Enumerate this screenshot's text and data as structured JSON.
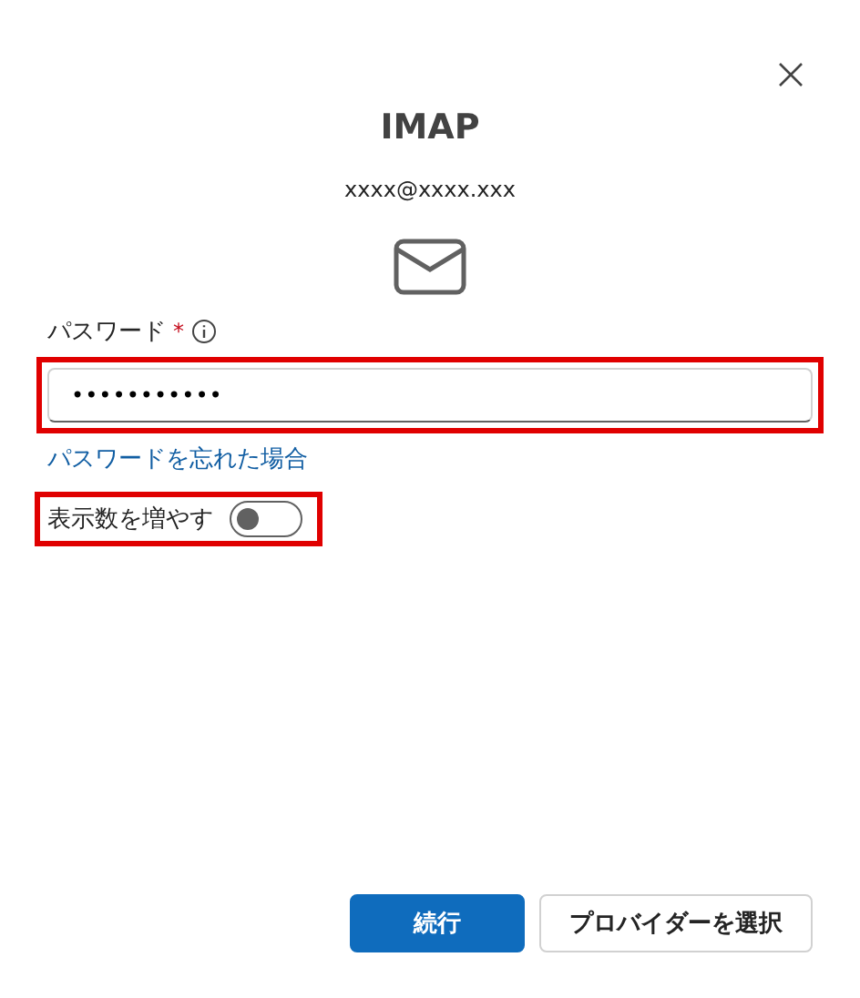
{
  "dialog": {
    "title": "IMAP",
    "account": "xxxx@xxxx.xxx"
  },
  "password": {
    "label": "パスワード",
    "required_mark": "*",
    "value": "•••••••••••",
    "highlighted": true
  },
  "forgot_link": "パスワードを忘れた場合",
  "toggle": {
    "label": "表示数を増やす",
    "on": false,
    "highlighted": true
  },
  "buttons": [
    {
      "label": "続行",
      "kind": "primary"
    },
    {
      "label": "プロバイダーを選択",
      "kind": "secondary"
    }
  ]
}
